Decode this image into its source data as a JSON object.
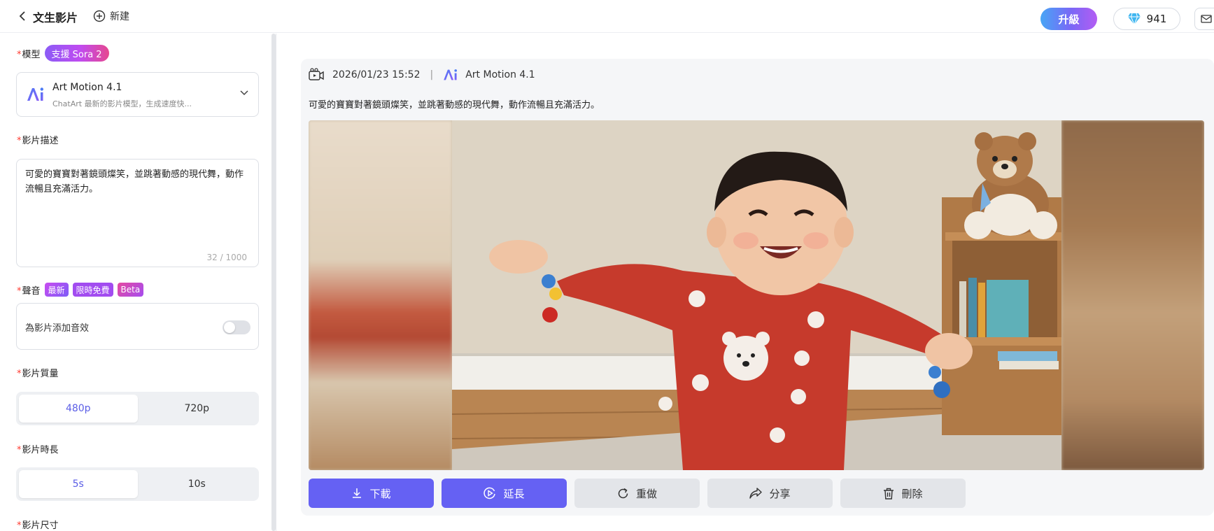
{
  "header": {
    "title": "文生影片",
    "new_label": "新建",
    "upgrade_label": "升級",
    "credits": "941"
  },
  "form": {
    "model": {
      "label": "模型",
      "badge": "支援 Sora 2",
      "name": "Art Motion 4.1",
      "desc": "ChatArt 最新的影片模型，生成速度快..."
    },
    "description": {
      "label": "影片描述",
      "text": "可愛的寶寶對著鏡頭燦笑，並跳著動感的現代舞，動作流暢且充滿活力。",
      "count": "32 / 1000"
    },
    "audio": {
      "label": "聲音",
      "badges": [
        "最新",
        "限時免費",
        "Beta"
      ],
      "toggle_text": "為影片添加音效",
      "enabled": false
    },
    "quality": {
      "label": "影片質量",
      "options": [
        "480p",
        "720p"
      ],
      "selected": "480p"
    },
    "duration": {
      "label": "影片時長",
      "options": [
        "5s",
        "10s"
      ],
      "selected": "5s"
    },
    "size": {
      "label": "影片尺寸"
    }
  },
  "result": {
    "timestamp": "2026/01/23 15:52",
    "model": "Art Motion 4.1",
    "prompt": "可愛的寶寶對著鏡頭燦笑，並跳著動感的現代舞，動作流暢且充滿活力。",
    "actions": {
      "download": "下載",
      "extend": "延長",
      "redo": "重做",
      "share": "分享",
      "delete": "刪除"
    }
  },
  "colors": {
    "accent": "#6561f3",
    "required": "#ff3b30"
  }
}
